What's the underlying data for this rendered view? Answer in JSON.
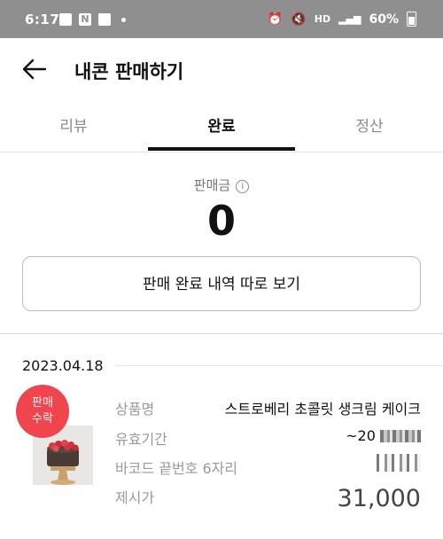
{
  "status_bar": {
    "time": "6:17",
    "network": "HD",
    "battery": "60%",
    "icons": [
      "gallery-icon",
      "naver-icon",
      "store-icon",
      "alarm-icon",
      "mute-icon",
      "wifi-icon",
      "signal-icon"
    ]
  },
  "header": {
    "title": "내콘 판매하기",
    "back_icon": "arrow-left-icon"
  },
  "tabs": [
    {
      "label": "리뷰",
      "active": false
    },
    {
      "label": "완료",
      "active": true
    },
    {
      "label": "정산",
      "active": false
    }
  ],
  "summary": {
    "label": "판매금",
    "info_icon": "i",
    "amount": "0",
    "history_button": "판매 완료 내역 따로 보기"
  },
  "sale": {
    "date": "2023.04.18",
    "badge": [
      "판매",
      "수락"
    ],
    "rows": [
      {
        "label": "상품명",
        "value": "스트로베리 초콜릿 생크림 케이크"
      },
      {
        "label": "유효기간",
        "value": "~20"
      },
      {
        "label": "바코드 끝번호 6자리",
        "value": ""
      },
      {
        "label": "제시가",
        "value": "31,000"
      }
    ]
  },
  "colors": {
    "status_bar": "#8f8f8f",
    "badge": "#f0454d",
    "tab_indicator": "#111111"
  }
}
